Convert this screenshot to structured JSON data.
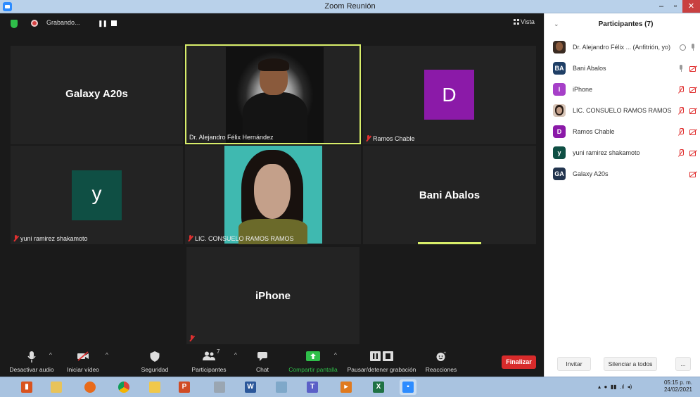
{
  "window": {
    "title": "Zoom Reunión"
  },
  "topbar": {
    "recording_label": "Grabando...",
    "view_label": "Vista"
  },
  "tiles": [
    {
      "id": "galaxy",
      "big_name": "Galaxy A20s"
    },
    {
      "id": "alejandro",
      "name": "Dr. Alejandro Félix Hernández"
    },
    {
      "id": "ramos",
      "avatar_letter": "D",
      "avatar_color": "#8b1aa8",
      "name": "Ramos Chable"
    },
    {
      "id": "yuni",
      "avatar_letter": "y",
      "avatar_color": "#0f4f44",
      "name": "yuni ramirez shakamoto"
    },
    {
      "id": "consuelo",
      "name": "LIC. CONSUELO RAMOS RAMOS"
    },
    {
      "id": "bani",
      "big_name": "Bani Abalos"
    },
    {
      "id": "iphone",
      "big_name": "iPhone"
    }
  ],
  "toolbar": {
    "mute_label": "Desactivar audio",
    "video_label": "Iniciar vídeo",
    "security_label": "Seguridad",
    "participants_label": "Participantes",
    "participants_count": "7",
    "chat_label": "Chat",
    "share_label": "Compartir pantalla",
    "record_label": "Pausar/detener grabación",
    "reactions_label": "Reacciones",
    "end_label": "Finalizar",
    "share_color": "#2fbf4a",
    "end_color": "#d82b2b"
  },
  "panel": {
    "title": "Participantes (7)",
    "participants": [
      {
        "name": "Dr. Alejandro Félix ... (Anfitrión, yo)",
        "avatar_text": "",
        "avatar_color": "#6b4a3a"
      },
      {
        "name": "Bani Abalos",
        "avatar_text": "BA",
        "avatar_color": "#1f3f66"
      },
      {
        "name": "iPhone",
        "avatar_text": "I",
        "avatar_color": "#a640c8"
      },
      {
        "name": "LIC. CONSUELO RAMOS RAMOS",
        "avatar_text": "",
        "avatar_color": "#b58a74"
      },
      {
        "name": "Ramos Chable",
        "avatar_text": "D",
        "avatar_color": "#8b1aa8"
      },
      {
        "name": "yuni ramirez shakamoto",
        "avatar_text": "y",
        "avatar_color": "#0f4f44"
      },
      {
        "name": "Galaxy A20s",
        "avatar_text": "GA",
        "avatar_color": "#22344e"
      }
    ],
    "invite_label": "Invitar",
    "mute_all_label": "Silenciar a todos",
    "more_label": "..."
  },
  "taskbar": {
    "time": "05:15 p. m.",
    "date": "24/02/2021"
  }
}
